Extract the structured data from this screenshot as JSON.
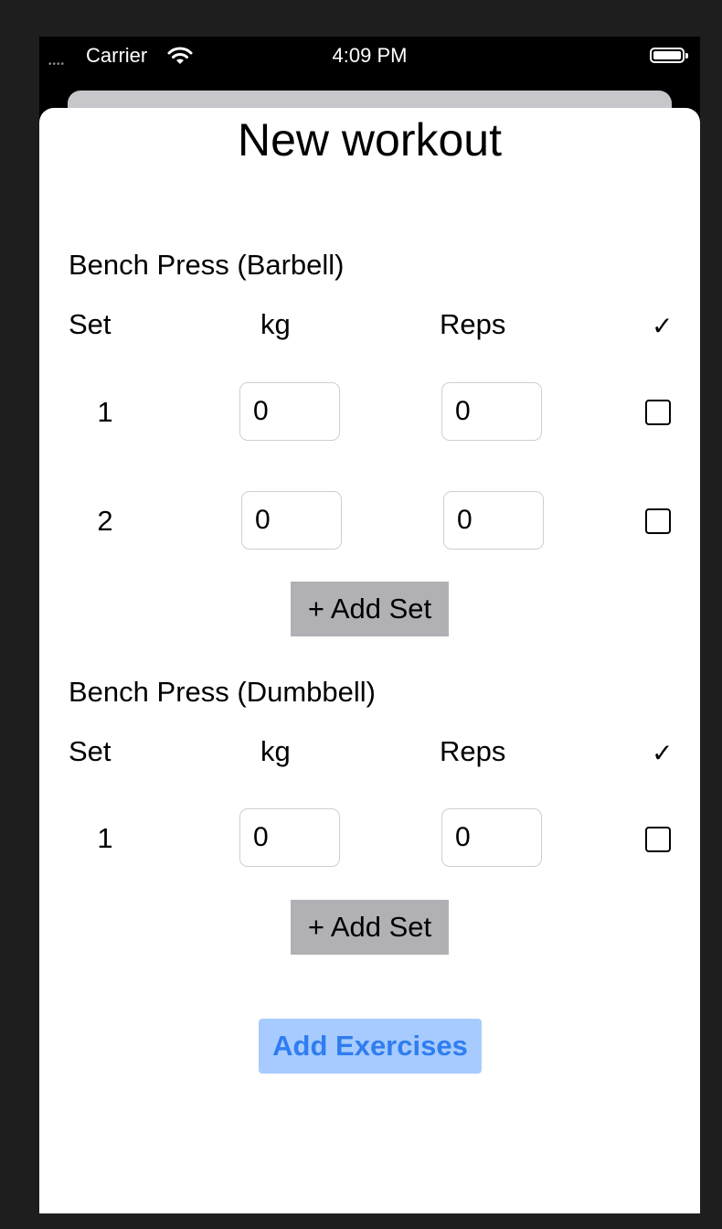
{
  "status_bar": {
    "signal": "••••",
    "carrier": "Carrier",
    "time": "4:09 PM"
  },
  "title": "New workout",
  "exercises": [
    {
      "name": "Bench Press (Barbell)",
      "headers": {
        "set": "Set",
        "kg": "kg",
        "reps": "Reps",
        "done": "✓"
      },
      "sets": [
        {
          "set": "1",
          "kg": "0",
          "reps": "0",
          "done": false
        },
        {
          "set": "2",
          "kg": "0",
          "reps": "0",
          "done": false
        }
      ],
      "add_set_label": "+ Add Set"
    },
    {
      "name": "Bench Press (Dumbbell)",
      "headers": {
        "set": "Set",
        "kg": "kg",
        "reps": "Reps",
        "done": "✓"
      },
      "sets": [
        {
          "set": "1",
          "kg": "0",
          "reps": "0",
          "done": false
        }
      ],
      "add_set_label": "+ Add Set"
    }
  ],
  "add_exercises_label": "Add Exercises",
  "colors": {
    "add_set_bg": "#b1b0b5",
    "add_exercises_bg": "#a7cbff",
    "add_exercises_text": "#2f7df0"
  },
  "icons": [
    "wifi-icon",
    "battery-icon",
    "checkmark-icon",
    "checkbox-icon"
  ]
}
